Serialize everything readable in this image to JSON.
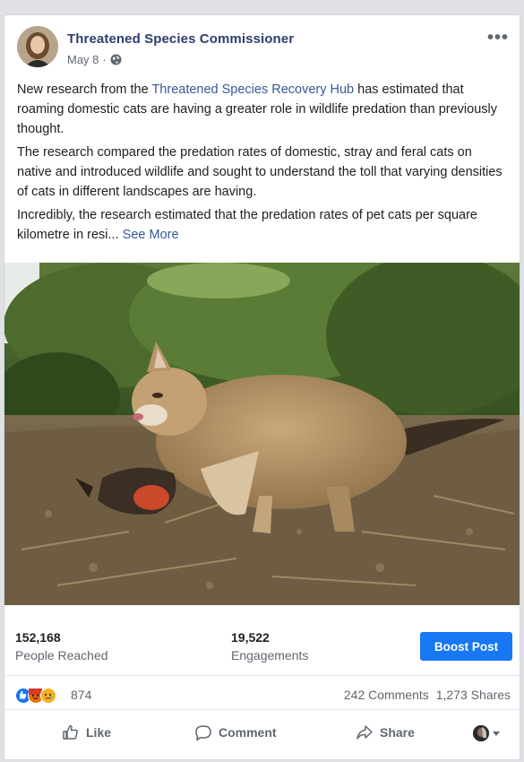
{
  "post": {
    "page_name": "Threatened Species Commissioner",
    "date": "May 8",
    "date_separator": "·",
    "privacy_icon": "globe-icon",
    "more_label": "•••",
    "paragraph1_before": "New research from the ",
    "paragraph1_link": "Threatened Species Recovery Hub",
    "paragraph1_after": " has estimated that roaming domestic cats are having a greater role in wildlife predation than previously thought.",
    "paragraph2": "The research compared the predation rates of domestic, stray and feral cats on native and introduced wildlife and sought to understand the toll that varying densities of cats in different landscapes are having.",
    "paragraph3": "Incredibly, the research estimated that the predation rates of pet cats per square kilometre in resi...",
    "see_more": "See More"
  },
  "stats": {
    "people_reached_value": "152,168",
    "people_reached_label": "People Reached",
    "engagements_value": "19,522",
    "engagements_label": "Engagements",
    "boost_label": "Boost Post"
  },
  "reactions": {
    "icons": [
      "like-reaction-icon",
      "angry-reaction-icon",
      "sad-reaction-icon"
    ],
    "count": "874",
    "comments": "242 Comments",
    "shares": "1,273 Shares"
  },
  "actions": {
    "like": "Like",
    "comment": "Comment",
    "share": "Share"
  },
  "colors": {
    "accent": "#1877f2",
    "link": "#385898",
    "page_name": "#2c3e6b"
  }
}
